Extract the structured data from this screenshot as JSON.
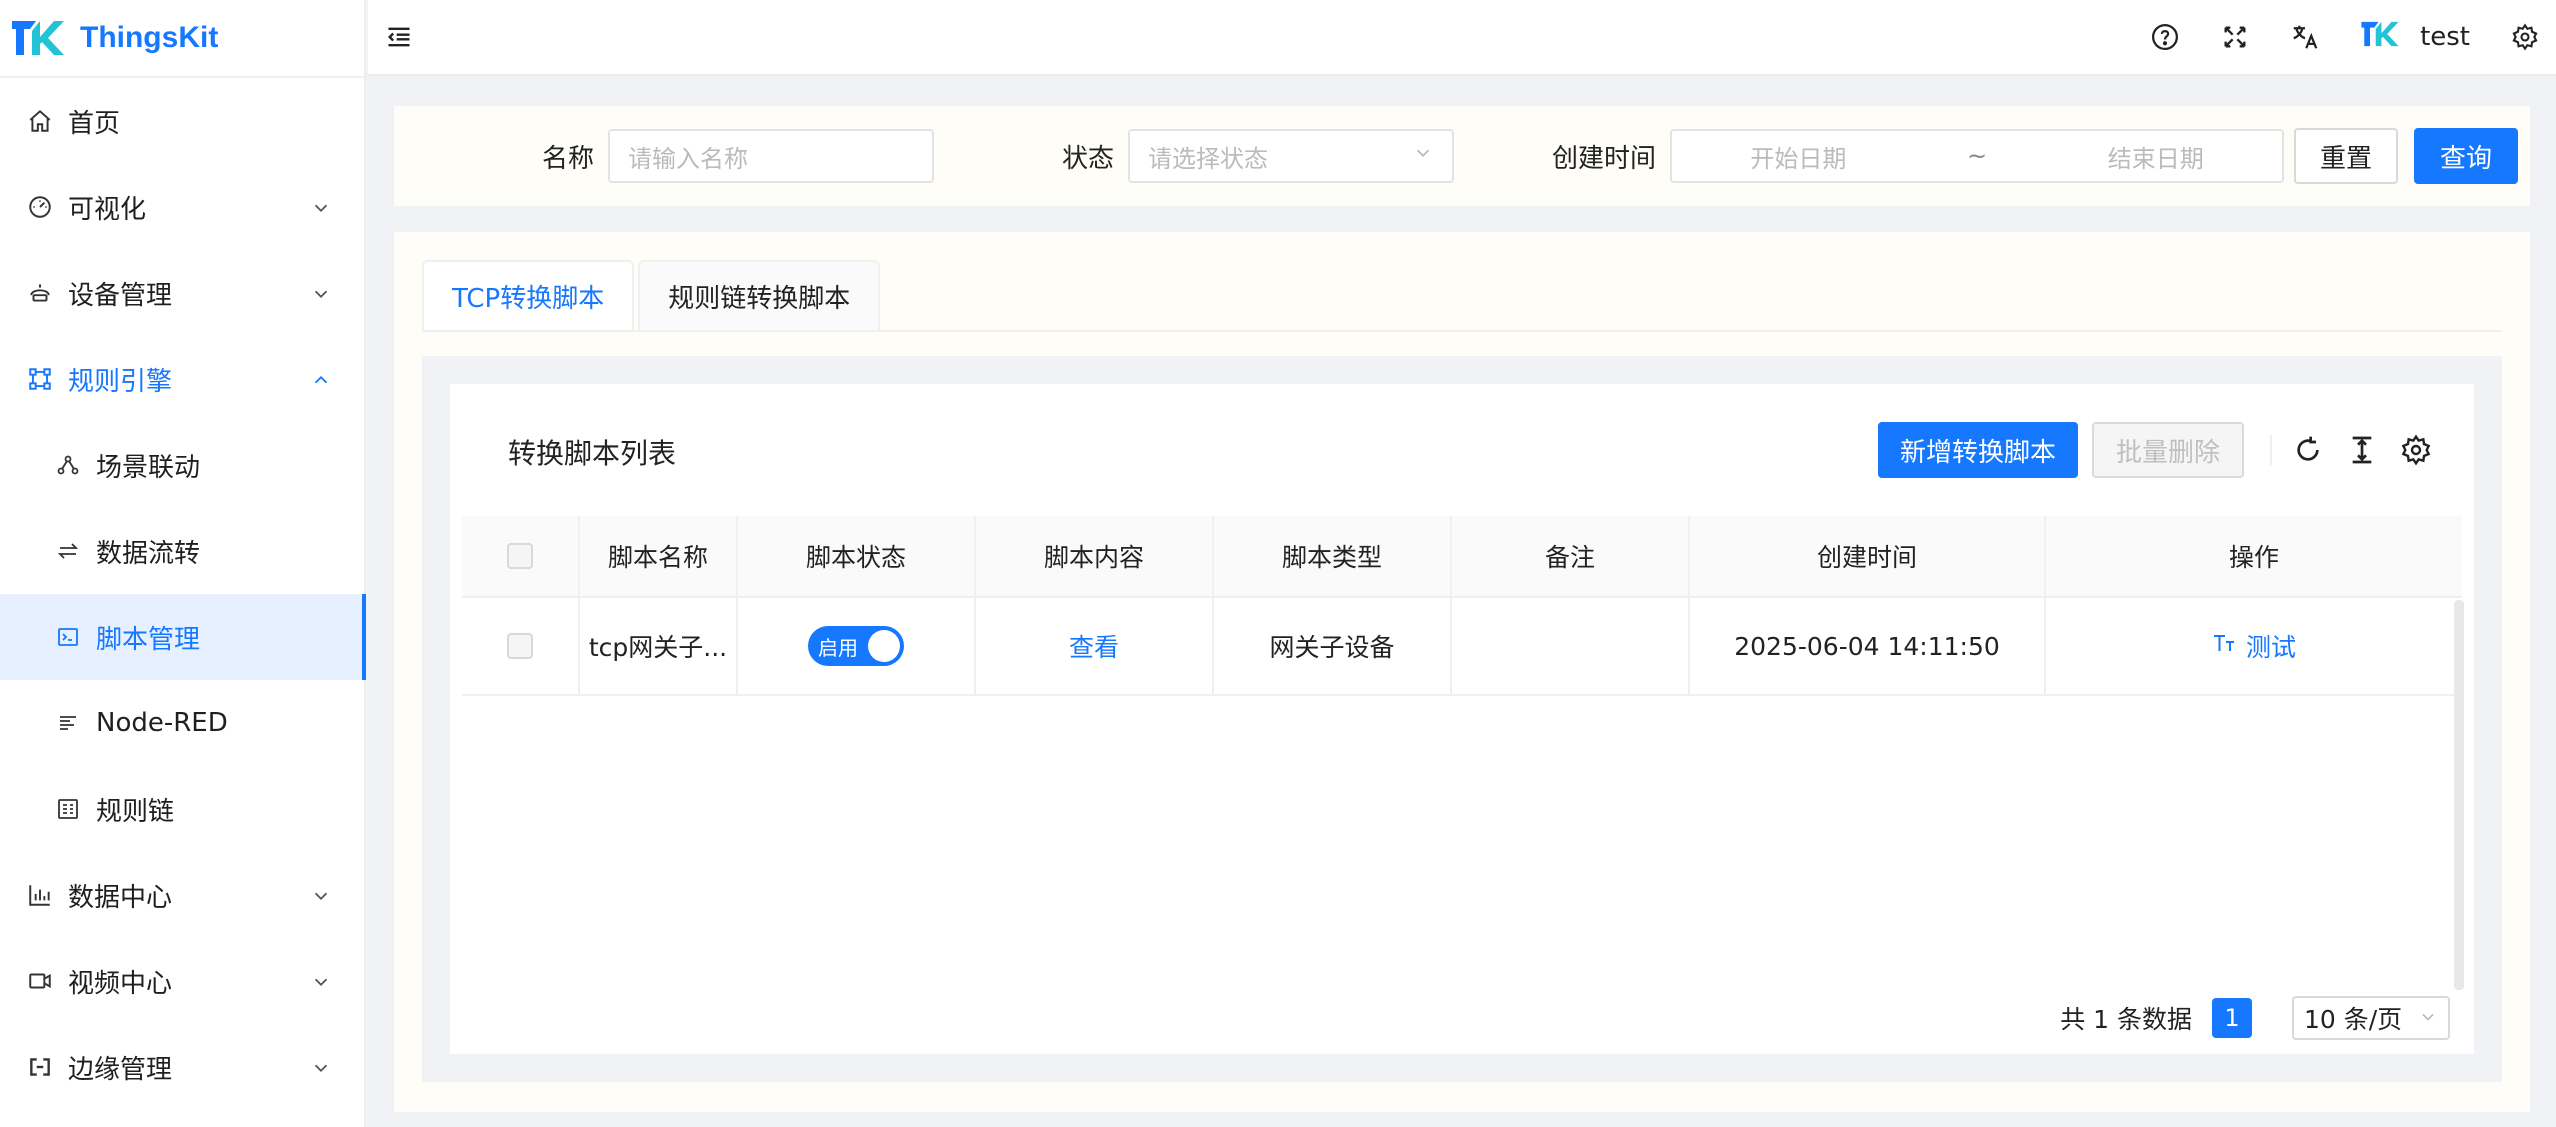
{
  "app": {
    "name": "ThingsKit"
  },
  "sidebar": {
    "items": [
      {
        "label": "首页",
        "icon": "home-icon"
      },
      {
        "label": "可视化",
        "icon": "dashboard-icon"
      },
      {
        "label": "设备管理",
        "icon": "device-icon"
      },
      {
        "label": "规则引擎",
        "icon": "rule-engine-icon"
      },
      {
        "label": "场景联动",
        "icon": "scene-icon"
      },
      {
        "label": "数据流转",
        "icon": "data-flow-icon"
      },
      {
        "label": "脚本管理",
        "icon": "script-icon"
      },
      {
        "label": "Node-RED",
        "icon": "node-red-icon"
      },
      {
        "label": "规则链",
        "icon": "rule-chain-icon"
      },
      {
        "label": "数据中心",
        "icon": "chart-icon"
      },
      {
        "label": "视频中心",
        "icon": "video-icon"
      },
      {
        "label": "边缘管理",
        "icon": "edge-icon"
      }
    ]
  },
  "header": {
    "username": "test"
  },
  "search": {
    "name_label": "名称",
    "name_placeholder": "请输入名称",
    "status_label": "状态",
    "status_placeholder": "请选择状态",
    "time_label": "创建时间",
    "start_placeholder": "开始日期",
    "range_sep": "~",
    "end_placeholder": "结束日期",
    "reset_label": "重置",
    "query_label": "查询"
  },
  "tabs": [
    "TCP转换脚本",
    "规则链转换脚本"
  ],
  "card": {
    "title": "转换脚本列表",
    "add_label": "新增转换脚本",
    "batch_delete_label": "批量删除"
  },
  "table": {
    "columns": [
      "脚本名称",
      "脚本状态",
      "脚本内容",
      "脚本类型",
      "备注",
      "创建时间",
      "操作"
    ],
    "rows": [
      {
        "name": "tcp网关子...",
        "status": "启用",
        "content": "查看",
        "type": "网关子设备",
        "remark": "",
        "created": "2025-06-04 14:11:50",
        "action": "测试"
      }
    ]
  },
  "pagination": {
    "total_text": "共 1 条数据",
    "current": "1",
    "page_size": "10 条/页"
  },
  "colors": {
    "primary": "#1677ff"
  }
}
